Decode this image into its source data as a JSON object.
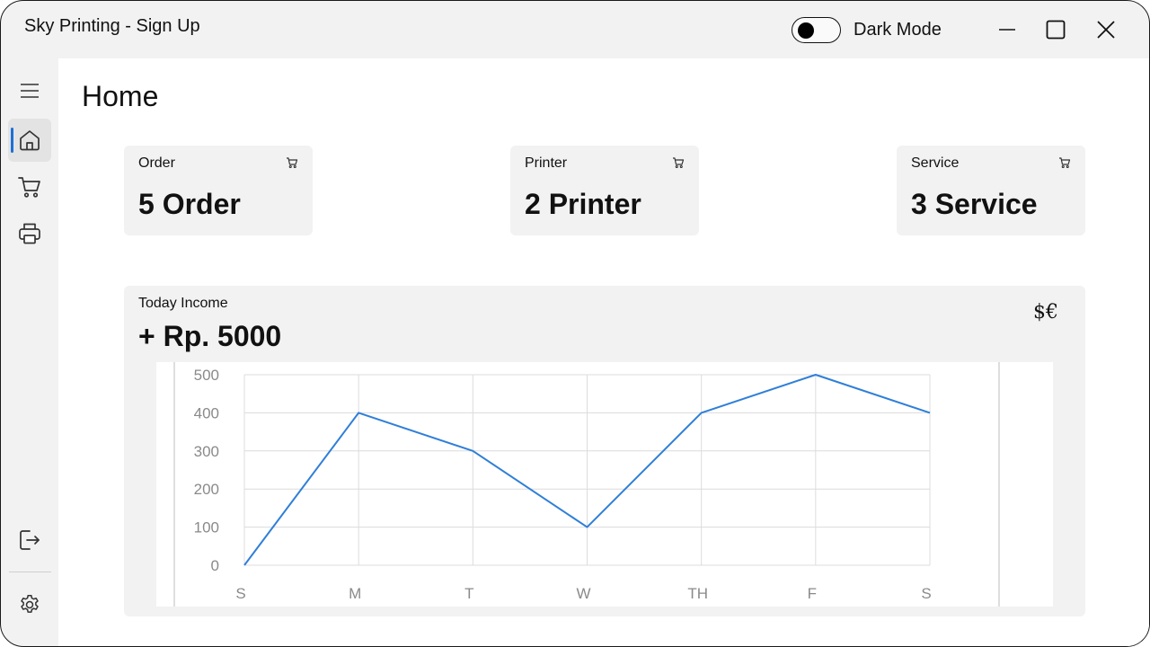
{
  "window": {
    "title": "Sky Printing - Sign Up",
    "dark_mode_label": "Dark Mode",
    "dark_mode_on": false
  },
  "sidebar": {
    "items": [
      {
        "icon": "hamburger-menu-icon"
      },
      {
        "icon": "home-icon",
        "active": true
      },
      {
        "icon": "cart-icon"
      },
      {
        "icon": "printer-icon"
      }
    ],
    "bottom_items": [
      {
        "icon": "logout-icon"
      },
      {
        "icon": "settings-gear-icon"
      }
    ]
  },
  "main": {
    "title": "Home",
    "cards": [
      {
        "label": "Order",
        "value": "5 Order",
        "icon": "cart-icon"
      },
      {
        "label": "Printer",
        "value": "2 Printer",
        "icon": "cart-icon"
      },
      {
        "label": "Service",
        "value": "3 Service",
        "icon": "cart-icon"
      }
    ],
    "income": {
      "label": "Today Income",
      "value": "+ Rp. 5000",
      "currency_icon": "$€"
    }
  },
  "colors": {
    "accent": "#1e6fd6",
    "line": "#2f7fd8"
  },
  "chart_data": {
    "type": "line",
    "categories": [
      "S",
      "M",
      "T",
      "W",
      "TH",
      "F",
      "S"
    ],
    "series": [
      {
        "values": [
          0,
          400,
          300,
          100,
          400,
          500,
          400
        ]
      }
    ],
    "ylim": [
      0,
      500
    ],
    "yticks": [
      0,
      100,
      200,
      300,
      400,
      500
    ],
    "grid": true,
    "title": "",
    "xlabel": "",
    "ylabel": ""
  }
}
